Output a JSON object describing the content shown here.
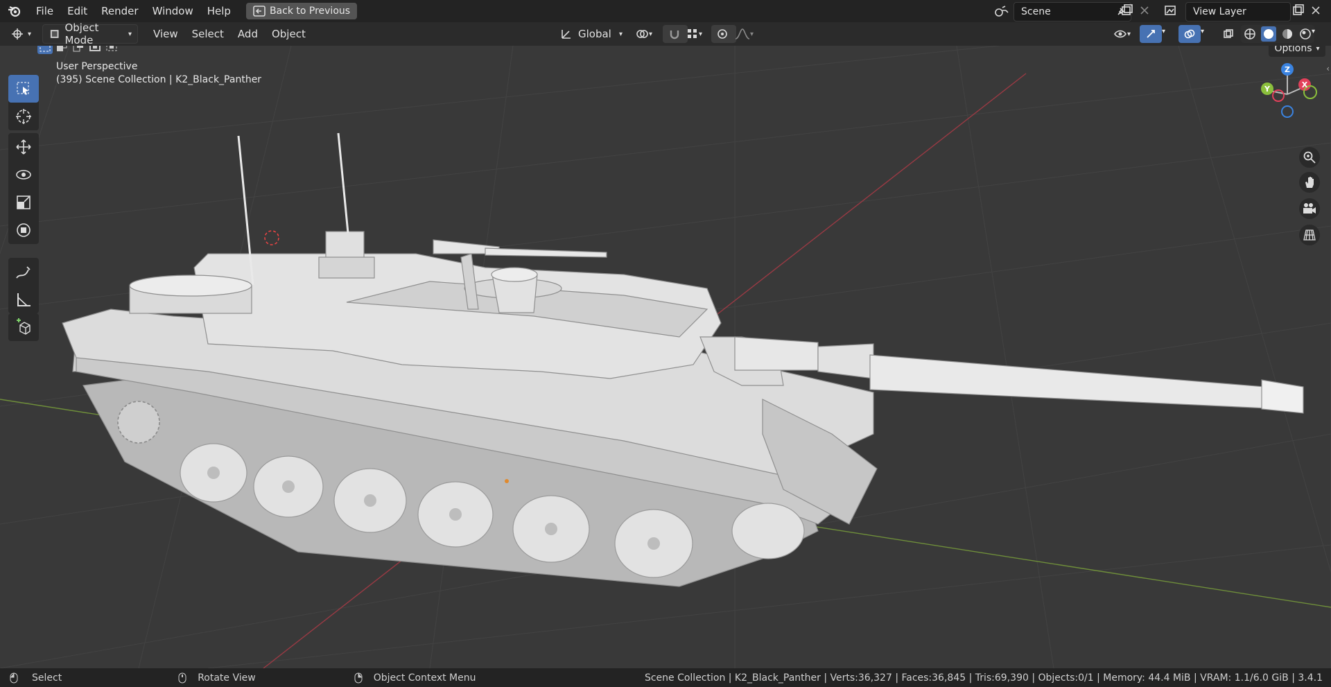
{
  "menu": {
    "file": "File",
    "edit": "Edit",
    "render": "Render",
    "window": "Window",
    "help": "Help"
  },
  "back_button": "Back to Previous",
  "scene": {
    "name": "Scene"
  },
  "view_layer": {
    "name": "View Layer"
  },
  "header": {
    "mode": "Object Mode",
    "view": "View",
    "select": "Select",
    "add": "Add",
    "object": "Object",
    "transform_orientation": "Global",
    "options": "Options"
  },
  "viewport": {
    "perspective": "User Perspective",
    "collection_info": "(395) Scene Collection | K2_Black_Panther"
  },
  "gizmo": {
    "z": "Z",
    "y": "Y",
    "x": "X"
  },
  "status": {
    "select": "Select",
    "rotate": "Rotate View",
    "context": "Object Context Menu",
    "info": "Scene Collection | K2_Black_Panther | Verts:36,327 | Faces:36,845 | Tris:69,390 | Objects:0/1 | Memory: 44.4 MiB | VRAM: 1.1/6.0 GiB | 3.4.1"
  },
  "colors": {
    "accent": "#4772b3",
    "x_axis": "#e2405a",
    "y_axis": "#8bbf3c",
    "z_axis": "#3a83e0"
  }
}
